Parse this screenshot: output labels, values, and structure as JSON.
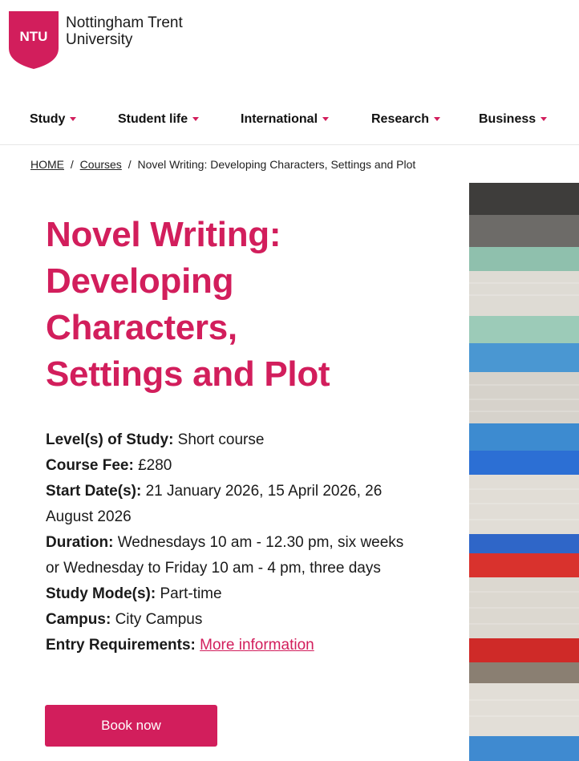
{
  "logo": {
    "badge_text": "NTU",
    "name_line1": "Nottingham Trent",
    "name_line2": "University",
    "brand_color": "#d21e5c"
  },
  "nav": {
    "items": [
      {
        "label": "Study"
      },
      {
        "label": "Student life"
      },
      {
        "label": "International"
      },
      {
        "label": "Research"
      },
      {
        "label": "Business"
      }
    ]
  },
  "breadcrumb": {
    "home": "HOME",
    "separator": "/",
    "courses": "Courses",
    "current": "Novel Writing: Developing Characters, Settings and Plot"
  },
  "course": {
    "title_lines": [
      "Novel Writing:",
      "Developing",
      "Characters,",
      "Settings and Plot"
    ],
    "details": {
      "level_label": "Level(s) of Study:",
      "level_value": " Short course",
      "fee_label": "Course Fee:",
      "fee_value": " £280",
      "start_label": "Start Date(s):",
      "start_value": " 21 January 2026, 15 April 2026, 26 August 2026",
      "duration_label": "Duration:",
      "duration_value": " Wednesdays 10 am - 12.30 pm, six weeks or Wednesday to Friday 10 am - 4 pm, three days",
      "mode_label": "Study Mode(s):",
      "mode_value": " Part-time",
      "campus_label": "Campus:",
      "campus_value": " City Campus",
      "entry_label": "Entry Requirements:",
      "entry_link": "More information"
    },
    "book_button": "Book now"
  },
  "hero_image": {
    "icon": "stacked-books-image"
  }
}
